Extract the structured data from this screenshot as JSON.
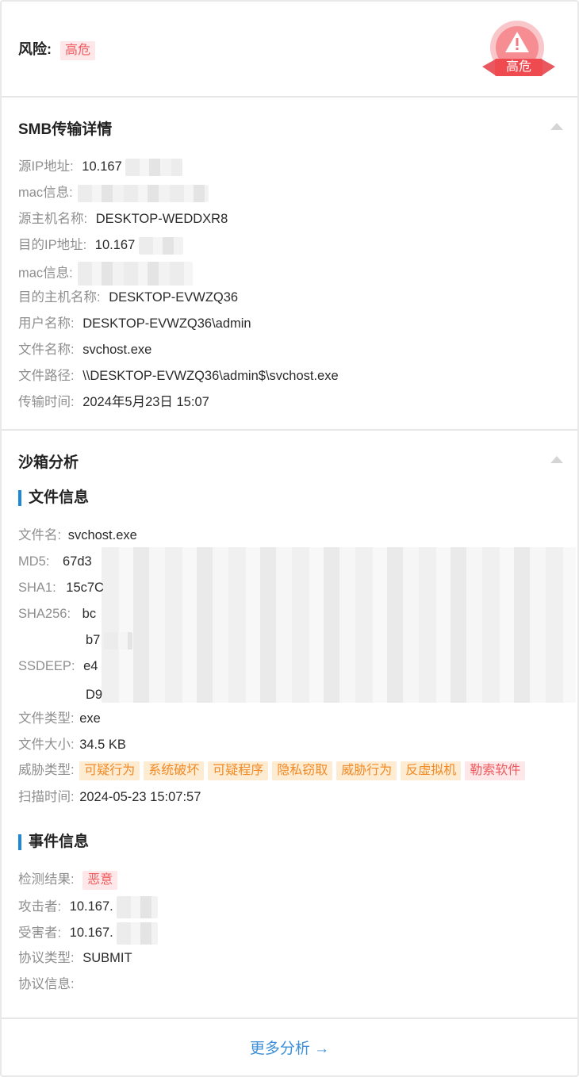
{
  "risk": {
    "label": "风险:",
    "level_tag": "高危",
    "seal_text": "高危"
  },
  "smb": {
    "title": "SMB传输详情",
    "rows": [
      {
        "label": "源IP地址:",
        "value": "10.167"
      },
      {
        "label": "mac信息:",
        "value": ""
      },
      {
        "label": "源主机名称:",
        "value": "DESKTOP-WEDDXR8"
      },
      {
        "label": "目的IP地址:",
        "value": "10.167"
      },
      {
        "label": "mac信息:",
        "value": ""
      },
      {
        "label": "目的主机名称:",
        "value": "DESKTOP-EVWZQ36"
      },
      {
        "label": "用户名称:",
        "value": "DESKTOP-EVWZQ36\\admin"
      },
      {
        "label": "文件名称:",
        "value": "svchost.exe"
      },
      {
        "label": "文件路径:",
        "value": "\\\\DESKTOP-EVWZQ36\\admin$\\svchost.exe"
      },
      {
        "label": "传输时间:",
        "value": "2024年5月23日 15:07"
      }
    ]
  },
  "sandbox": {
    "title": "沙箱分析",
    "file_info_title": "文件信息",
    "file_rows": {
      "filename": {
        "label": "文件名:",
        "value": "svchost.exe"
      },
      "md5": {
        "label": "MD5:",
        "value": "67d3"
      },
      "sha1": {
        "label": "SHA1:",
        "value": "15c7C"
      },
      "sha256": {
        "label": "SHA256:",
        "value": "bc",
        "value2": "b7"
      },
      "ssdeep": {
        "label": "SSDEEP:",
        "value": "e4",
        "value2": "D9"
      },
      "filetype": {
        "label": "文件类型:",
        "value": "exe"
      },
      "filesize": {
        "label": "文件大小:",
        "value": "34.5 KB"
      },
      "threat": {
        "label": "威胁类型:",
        "tags": [
          "可疑行为",
          "系统破坏",
          "可疑程序",
          "隐私窃取",
          "威胁行为",
          "反虚拟机",
          "勒索软件"
        ]
      },
      "scantime": {
        "label": "扫描时间:",
        "value": "2024-05-23 15:07:57"
      }
    },
    "event_info_title": "事件信息",
    "event_rows": {
      "result": {
        "label": "检测结果:",
        "tag": "恶意"
      },
      "attacker": {
        "label": "攻击者:",
        "value": "10.167."
      },
      "victim": {
        "label": "受害者:",
        "value": "10.167."
      },
      "protocol_type": {
        "label": "协议类型:",
        "value": "SUBMIT"
      },
      "protocol_info": {
        "label": "协议信息:",
        "value": ""
      }
    }
  },
  "footer": {
    "more_label": "更多分析 →"
  },
  "colors": {
    "danger": "#ee5a5e",
    "warning": "#f28a25",
    "link": "#3c8fd6",
    "accent_bar": "#1e88d8"
  }
}
